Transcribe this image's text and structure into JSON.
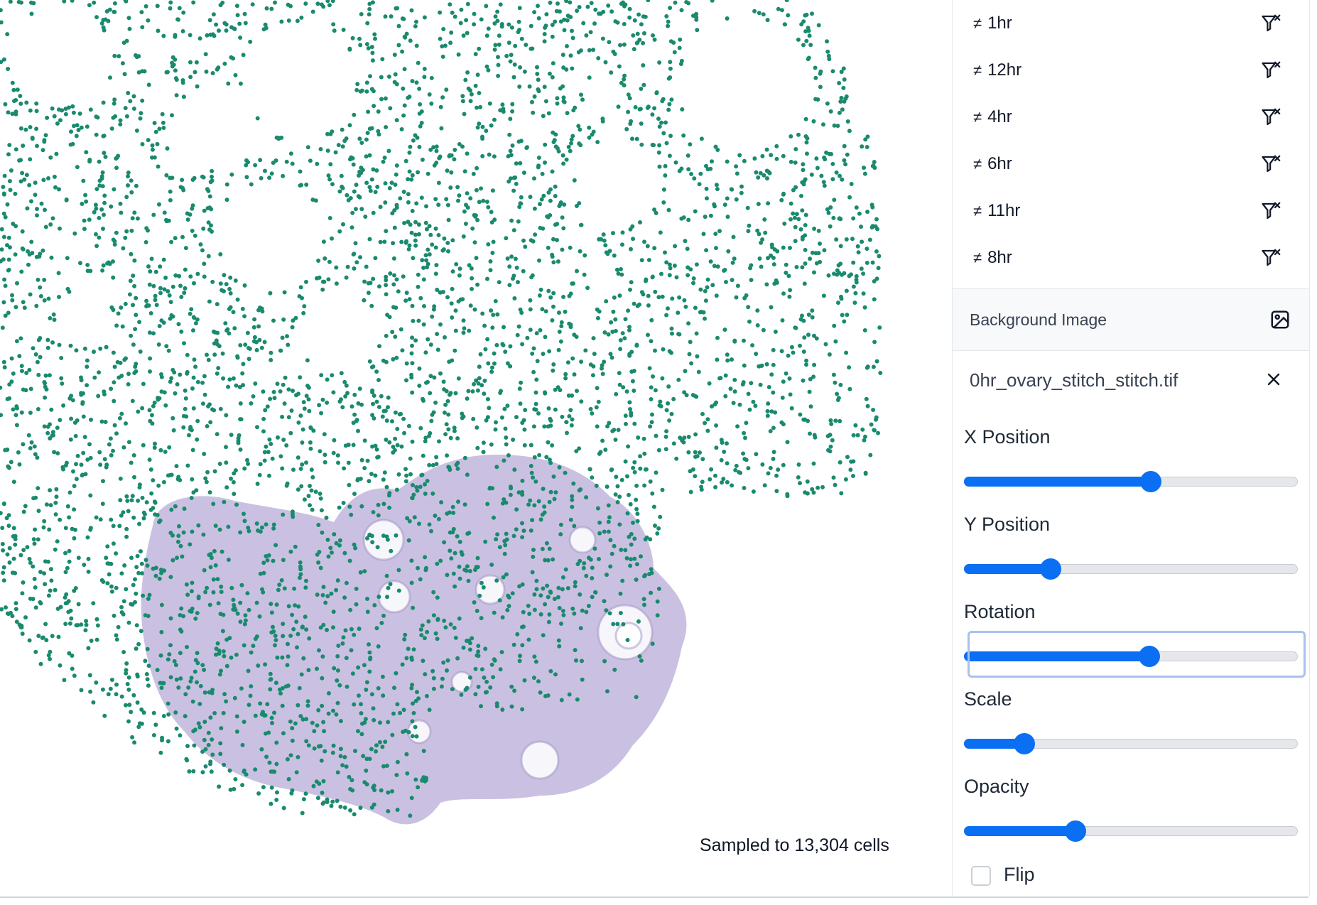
{
  "viz": {
    "sample_note": "Sampled to 13,304 cells",
    "point_color": "#1a8a6e",
    "tissue_color": "#b8acd8"
  },
  "filters": {
    "items": [
      {
        "symbol": "≠",
        "label": "1hr"
      },
      {
        "symbol": "≠",
        "label": "12hr"
      },
      {
        "symbol": "≠",
        "label": "4hr"
      },
      {
        "symbol": "≠",
        "label": "6hr"
      },
      {
        "symbol": "≠",
        "label": "11hr"
      },
      {
        "symbol": "≠",
        "label": "8hr"
      }
    ],
    "icon": "filter-remove-icon"
  },
  "background_image": {
    "section_title": "Background Image",
    "section_icon": "image-icon",
    "file_name": "0hr_ovary_stitch_stitch.tif",
    "close_icon": "close-icon",
    "controls": [
      {
        "label": "X Position",
        "value": 0.56
      },
      {
        "label": "Y Position",
        "value": 0.26
      },
      {
        "label": "Rotation",
        "value": 0.555
      },
      {
        "label": "Scale",
        "value": 0.18
      },
      {
        "label": "Opacity",
        "value": 0.335
      }
    ],
    "flip_label": "Flip",
    "flip_checked": false,
    "accent": "#0a6ff2"
  }
}
